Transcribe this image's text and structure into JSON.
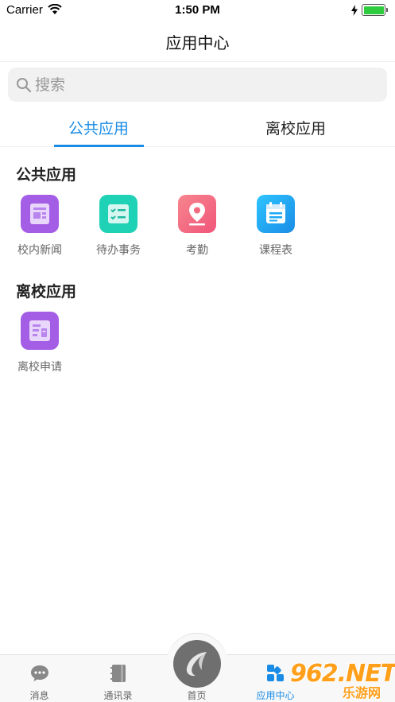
{
  "status_bar": {
    "carrier": "Carrier",
    "time": "1:50 PM"
  },
  "nav": {
    "title": "应用中心"
  },
  "search": {
    "placeholder": "搜索"
  },
  "tabs": [
    {
      "label": "公共应用",
      "active": true
    },
    {
      "label": "离校应用",
      "active": false
    }
  ],
  "sections": [
    {
      "title": "公共应用",
      "apps": [
        {
          "label": "校内新闻",
          "icon": "news-icon",
          "color": "#a45ee6"
        },
        {
          "label": "待办事务",
          "icon": "todo-icon",
          "color": "#1fd1b5"
        },
        {
          "label": "考勤",
          "icon": "location-pin-icon",
          "color": "#f76b82"
        },
        {
          "label": "课程表",
          "icon": "calendar-icon",
          "color": "#1aa9f5"
        }
      ]
    },
    {
      "title": "离校应用",
      "apps": [
        {
          "label": "离校申请",
          "icon": "application-form-icon",
          "color": "#a45ee6"
        }
      ]
    }
  ],
  "tab_bar": {
    "items": [
      {
        "label": "消息",
        "icon": "chat-bubble-icon"
      },
      {
        "label": "通讯录",
        "icon": "contacts-book-icon"
      },
      {
        "label": "首页",
        "icon": "home-logo-icon"
      },
      {
        "label": "应用中心",
        "icon": "app-grid-icon",
        "active": true
      }
    ]
  },
  "watermark": {
    "big": "962.NET",
    "small": "乐游网"
  },
  "colors": {
    "accent": "#1a8ce6",
    "battery": "#2fcc3f"
  }
}
